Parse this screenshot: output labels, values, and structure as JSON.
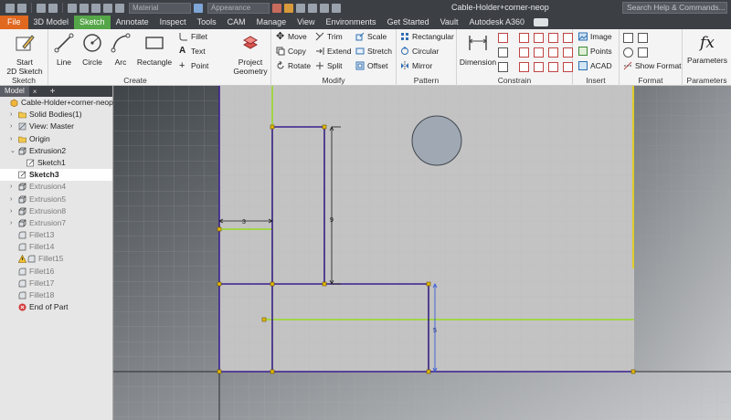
{
  "titlebar": {
    "doc_title": "Cable-Holder+corner-neop",
    "material": "Material",
    "appearance": "Appearance",
    "search_placeholder": "Search Help & Commands..."
  },
  "tabs": [
    "File",
    "3D Model",
    "Sketch",
    "Annotate",
    "Inspect",
    "Tools",
    "CAM",
    "Manage",
    "View",
    "Environments",
    "Get Started",
    "Vault",
    "Autodesk A360"
  ],
  "active_tab": "Sketch",
  "ribbon": {
    "sketch": {
      "title": "Sketch",
      "start": "Start",
      "start2": "2D Sketch"
    },
    "create": {
      "title": "Create",
      "line": "Line",
      "circle": "Circle",
      "arc": "Arc",
      "rectangle": "Rectangle",
      "fillet": "Fillet",
      "text": "Text",
      "point": "Point"
    },
    "project": {
      "line1": "Project",
      "line2": "Geometry"
    },
    "modify": {
      "title": "Modify",
      "move": "Move",
      "copy": "Copy",
      "rotate": "Rotate",
      "trim": "Trim",
      "extend": "Extend",
      "split": "Split",
      "scale": "Scale",
      "stretch": "Stretch",
      "offset": "Offset"
    },
    "pattern": {
      "title": "Pattern",
      "rectangular": "Rectangular",
      "circular": "Circular",
      "mirror": "Mirror"
    },
    "constrain": {
      "title": "Constrain",
      "dimension": "Dimension"
    },
    "insert": {
      "title": "Insert",
      "image": "Image",
      "points": "Points",
      "acad": "ACAD"
    },
    "format": {
      "title": "Format",
      "show_format": "Show Format"
    },
    "parameters": {
      "title": "Parameters",
      "label": "Parameters"
    }
  },
  "browser": {
    "tab": "Model",
    "items": [
      {
        "label": "Cable-Holder+corner-neop",
        "indent": 0,
        "icon": "part-icon",
        "expander": ""
      },
      {
        "label": "Solid Bodies(1)",
        "indent": 1,
        "icon": "folder-icon",
        "expander": "›"
      },
      {
        "label": "View: Master",
        "indent": 1,
        "icon": "view-icon",
        "expander": "›"
      },
      {
        "label": "Origin",
        "indent": 1,
        "icon": "folder-icon",
        "expander": "›"
      },
      {
        "label": "Extrusion2",
        "indent": 1,
        "icon": "extrusion-icon",
        "expander": "⌄"
      },
      {
        "label": "Sketch1",
        "indent": 2,
        "icon": "sketch-icon",
        "expander": ""
      },
      {
        "label": "Sketch3",
        "indent": 1,
        "icon": "sketch-icon",
        "expander": "",
        "selected": true
      },
      {
        "label": "Extrusion4",
        "indent": 1,
        "icon": "extrusion-icon",
        "expander": "›",
        "dim": true
      },
      {
        "label": "Extrusion5",
        "indent": 1,
        "icon": "extrusion-icon",
        "expander": "›",
        "dim": true
      },
      {
        "label": "Extrusion8",
        "indent": 1,
        "icon": "extrusion-icon",
        "expander": "›",
        "dim": true
      },
      {
        "label": "Extrusion7",
        "indent": 1,
        "icon": "extrusion-icon",
        "expander": "›",
        "dim": true
      },
      {
        "label": "Fillet13",
        "indent": 1,
        "icon": "fillet-icon",
        "expander": "",
        "dim": true
      },
      {
        "label": "Fillet14",
        "indent": 1,
        "icon": "fillet-icon",
        "expander": "",
        "dim": true
      },
      {
        "label": "Fillet15",
        "indent": 1,
        "icon": "warning-icon",
        "expander": "",
        "dim": true
      },
      {
        "label": "Fillet16",
        "indent": 1,
        "icon": "fillet-icon",
        "expander": "",
        "dim": true
      },
      {
        "label": "Fillet17",
        "indent": 1,
        "icon": "fillet-icon",
        "expander": "",
        "dim": true
      },
      {
        "label": "Fillet18",
        "indent": 1,
        "icon": "fillet-icon",
        "expander": "",
        "dim": true
      },
      {
        "label": "End of Part",
        "indent": 1,
        "icon": "end-of-part-icon",
        "expander": ""
      }
    ]
  },
  "canvas": {
    "dimensions": [
      "3",
      "9",
      "5"
    ]
  },
  "colors": {
    "accent_tab": "#55a648",
    "file_tab": "#e0681f",
    "sketch_line": "#3b1e8f",
    "projected_line": "#8ee000",
    "constraint_point": "#e3b800"
  }
}
